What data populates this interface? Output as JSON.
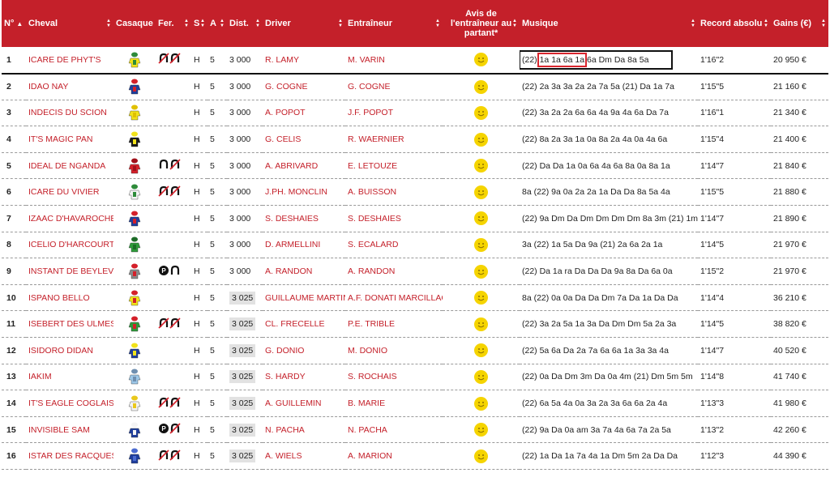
{
  "headers": {
    "num": "N°",
    "num_sort_arrow": "▲",
    "cheval": "Cheval",
    "casaque": "Casaque",
    "fer": "Fer.",
    "sexe": "S",
    "age": "A",
    "dist": "Dist.",
    "driver": "Driver",
    "entraineur": "Entraîneur",
    "avis": "Avis de l'entraîneur au partant*",
    "musique": "Musique",
    "record": "Record absolu",
    "gains": "Gains (€)"
  },
  "colors": {
    "header_bg": "#c4202a",
    "link_red": "#c4202a",
    "smiley": "#f5d400",
    "highlight_red": "#d9262e"
  },
  "rows": [
    {
      "num": "1",
      "cheval": "ICARE DE PHYT'S",
      "silk": "yellow-green",
      "fer": "D4",
      "sexe": "H",
      "age": "5",
      "dist": "3 000",
      "dist_boxed": false,
      "driver": "R. LAMY",
      "entraineur": "M. VARIN",
      "musique_pre": "(22) ",
      "musique_mark": "1a 1a 6a 1a",
      "musique_post": " 6a Dm Da 8a 5a",
      "record": "1'16\"2",
      "gains": "20 950 €"
    },
    {
      "num": "2",
      "cheval": "IDAO NAY",
      "silk": "blue-red",
      "fer": "",
      "sexe": "H",
      "age": "5",
      "dist": "3 000",
      "dist_boxed": false,
      "driver": "G. COGNE",
      "entraineur": "G. COGNE",
      "musique": "(22) 2a 3a 3a 2a 2a 7a 5a (21) Da 1a 7a",
      "record": "1'15\"5",
      "gains": "21 160 €"
    },
    {
      "num": "3",
      "cheval": "INDECIS DU SCION",
      "silk": "yellow",
      "fer": "",
      "sexe": "H",
      "age": "5",
      "dist": "3 000",
      "dist_boxed": false,
      "driver": "A. POPOT",
      "entraineur": "J.F. POPOT",
      "musique": "(22) 3a 2a 2a 6a 6a 4a 9a 4a 6a Da 7a",
      "record": "1'16\"1",
      "gains": "21 340 €"
    },
    {
      "num": "4",
      "cheval": "IT'S MAGIC PAN",
      "silk": "black-yellow",
      "fer": "",
      "sexe": "H",
      "age": "5",
      "dist": "3 000",
      "dist_boxed": false,
      "driver": "G. CELIS",
      "entraineur": "R. WAERNIER",
      "musique": "(22) 8a 2a 3a 1a 0a 8a 2a 4a 0a 4a 6a",
      "record": "1'15\"4",
      "gains": "21 400 €"
    },
    {
      "num": "5",
      "cheval": "IDEAL DE NGANDA",
      "silk": "red",
      "fer": "DP",
      "sexe": "H",
      "age": "5",
      "dist": "3 000",
      "dist_boxed": false,
      "driver": "A. ABRIVARD",
      "entraineur": "E. LETOUZE",
      "musique": "(22) Da Da 1a 0a 6a 4a 6a 8a 0a 8a 1a",
      "record": "1'14\"7",
      "gains": "21 840 €"
    },
    {
      "num": "6",
      "cheval": "ICARE DU VIVIER",
      "silk": "white-green",
      "fer": "D4",
      "sexe": "H",
      "age": "5",
      "dist": "3 000",
      "dist_boxed": false,
      "driver": "J.PH. MONCLIN",
      "entraineur": "A. BUISSON",
      "musique": "8a (22) 9a 0a 2a 2a 1a Da Da 8a 5a 4a",
      "record": "1'15\"5",
      "gains": "21 880 €"
    },
    {
      "num": "7",
      "cheval": "IZAAC D'HAVAROCHE",
      "silk": "blue-red",
      "fer": "",
      "sexe": "H",
      "age": "5",
      "dist": "3 000",
      "dist_boxed": false,
      "driver": "S. DESHAIES",
      "entraineur": "S. DESHAIES",
      "musique": "(22) 9a Dm Da Dm Dm Dm Dm 8a 3m (21) 1m",
      "record": "1'14\"7",
      "gains": "21 890 €"
    },
    {
      "num": "8",
      "cheval": "ICELIO D'HARCOURT",
      "silk": "green",
      "fer": "",
      "sexe": "H",
      "age": "5",
      "dist": "3 000",
      "dist_boxed": false,
      "driver": "D. ARMELLINI",
      "entraineur": "S. ECALARD",
      "musique": "3a (22) 1a 5a Da 9a (21) 2a 6a 2a 1a",
      "record": "1'14\"5",
      "gains": "21 970 €"
    },
    {
      "num": "9",
      "cheval": "INSTANT DE BEYLEV",
      "silk": "grey-red",
      "fer": "PA",
      "sexe": "H",
      "age": "5",
      "dist": "3 000",
      "dist_boxed": false,
      "driver": "A. RANDON",
      "entraineur": "A. RANDON",
      "musique": "(22) Da 1a ra Da Da Da 9a 8a Da 6a 0a",
      "record": "1'15\"2",
      "gains": "21 970 €"
    },
    {
      "num": "10",
      "cheval": "ISPANO BELLO",
      "silk": "yellow-red",
      "fer": "",
      "sexe": "H",
      "age": "5",
      "dist": "3 025",
      "dist_boxed": true,
      "driver": "GUILLAUME MARTIN",
      "entraineur": "A.F. DONATI MARCILLAC",
      "musique": "8a (22) 0a 0a Da Da Dm 7a Da 1a Da Da",
      "record": "1'14\"4",
      "gains": "36 210 €"
    },
    {
      "num": "11",
      "cheval": "ISEBERT DES ULMES",
      "silk": "green-red",
      "fer": "D4",
      "sexe": "H",
      "age": "5",
      "dist": "3 025",
      "dist_boxed": true,
      "driver": "CL. FRECELLE",
      "entraineur": "P.E. TRIBLE",
      "musique": "(22) 3a 2a 5a 1a 3a Da Dm Dm 5a 2a 3a",
      "record": "1'14\"5",
      "gains": "38 820 €"
    },
    {
      "num": "12",
      "cheval": "ISIDORO DIDAN",
      "silk": "blue-yellow",
      "fer": "",
      "sexe": "H",
      "age": "5",
      "dist": "3 025",
      "dist_boxed": true,
      "driver": "G. DONIO",
      "entraineur": "M. DONIO",
      "musique": "(22) 5a 6a Da 2a 7a 6a 6a 1a 3a 3a 4a",
      "record": "1'14\"7",
      "gains": "40 520 €"
    },
    {
      "num": "13",
      "cheval": "IAKIM",
      "silk": "lightblue",
      "fer": "",
      "sexe": "H",
      "age": "5",
      "dist": "3 025",
      "dist_boxed": true,
      "driver": "S. HARDY",
      "entraineur": "S. ROCHAIS",
      "musique": "(22) 0a Da Dm 3m Da 0a 4m (21) Dm 5m 5m",
      "record": "1'14\"8",
      "gains": "41 740 €"
    },
    {
      "num": "14",
      "cheval": "IT'S EAGLE COGLAIS",
      "silk": "white-yellow",
      "fer": "D4",
      "sexe": "H",
      "age": "5",
      "dist": "3 025",
      "dist_boxed": true,
      "driver": "A. GUILLEMIN",
      "entraineur": "B. MARIE",
      "musique": "(22) 6a 5a 4a 0a 3a 2a 3a 6a 6a 2a 4a",
      "record": "1'13\"3",
      "gains": "41 980 €"
    },
    {
      "num": "15",
      "cheval": "INVISIBLE SAM",
      "silk": "blue-white",
      "fer": "PP",
      "sexe": "H",
      "age": "5",
      "dist": "3 025",
      "dist_boxed": true,
      "driver": "N. PACHA",
      "entraineur": "N. PACHA",
      "musique": "(22) 9a Da 0a am 3a 7a 4a 6a 7a 2a 5a",
      "record": "1'13\"2",
      "gains": "42 260 €"
    },
    {
      "num": "16",
      "cheval": "ISTAR DES RACQUES",
      "silk": "blue",
      "fer": "D4",
      "sexe": "H",
      "age": "5",
      "dist": "3 025",
      "dist_boxed": true,
      "driver": "A. WIELS",
      "entraineur": "A. MARION",
      "musique": "(22) 1a Da 1a 7a 4a 1a Dm 5m 2a Da Da",
      "record": "1'12\"3",
      "gains": "44 390 €"
    }
  ]
}
